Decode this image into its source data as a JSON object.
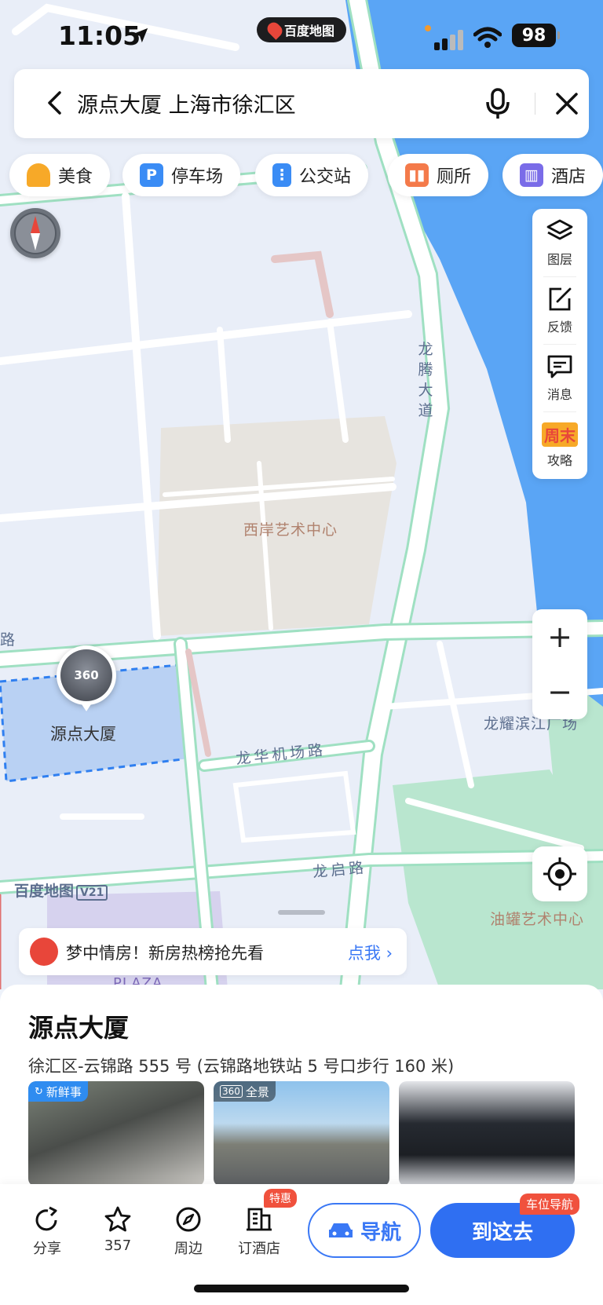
{
  "status": {
    "time": "11:05",
    "app_name": "百度地图",
    "battery": "98"
  },
  "search": {
    "query": "源点大厦 上海市徐汇区"
  },
  "categories": [
    {
      "label": "美食",
      "icon": "food-icon",
      "color": "#f7a928"
    },
    {
      "label": "停车场",
      "icon": "parking-icon",
      "color": "#3a8cf5"
    },
    {
      "label": "公交站",
      "icon": "bus-stop-icon",
      "color": "#3a8cf5"
    },
    {
      "label": "厕所",
      "icon": "toilet-icon",
      "color": "#f47a4a"
    },
    {
      "label": "酒店",
      "icon": "hotel-icon",
      "color": "#7a6ce8"
    }
  ],
  "tools": [
    {
      "label": "图层",
      "icon": "layers-icon"
    },
    {
      "label": "反馈",
      "icon": "feedback-icon"
    },
    {
      "label": "消息",
      "icon": "message-icon"
    },
    {
      "label": "攻略",
      "icon": "weekend-guide-icon",
      "badge": "周末"
    }
  ],
  "zoom": {
    "in": "+",
    "out": "−"
  },
  "map": {
    "labels": {
      "art_center": "西岸艺术中心",
      "longteng": "龙腾大道",
      "longhua_airport_rd": "龙华机场路",
      "longqi_rd": "龙启路",
      "longyao_plaza": "龙耀滨江广场",
      "oil_tank_art": "油罐艺术中心",
      "road_fragment": "锦路",
      "plaza": "PLAZA"
    },
    "poi_badge": "360",
    "poi_name": "源点大厦",
    "watermark": "百度地图",
    "watermark_version": "V21"
  },
  "promo": {
    "text": "梦中情房！新房热榜抢先看",
    "link": "点我"
  },
  "place": {
    "title": "源点大厦",
    "address": "徐汇区-云锦路 555 号 (云锦路地铁站 5 号口步行 160 米)",
    "photos": [
      {
        "tag": "新鲜事"
      },
      {
        "tag": "全景"
      },
      {
        "tag": ""
      }
    ]
  },
  "actions": [
    {
      "label": "分享",
      "icon": "share-icon"
    },
    {
      "label": "357",
      "icon": "star-icon"
    },
    {
      "label": "周边",
      "icon": "compass-icon"
    },
    {
      "label": "订酒店",
      "icon": "hotel-book-icon",
      "badge": "特惠"
    }
  ],
  "nav_button": "导航",
  "go_button": "到这去",
  "go_badge": "车位导航"
}
